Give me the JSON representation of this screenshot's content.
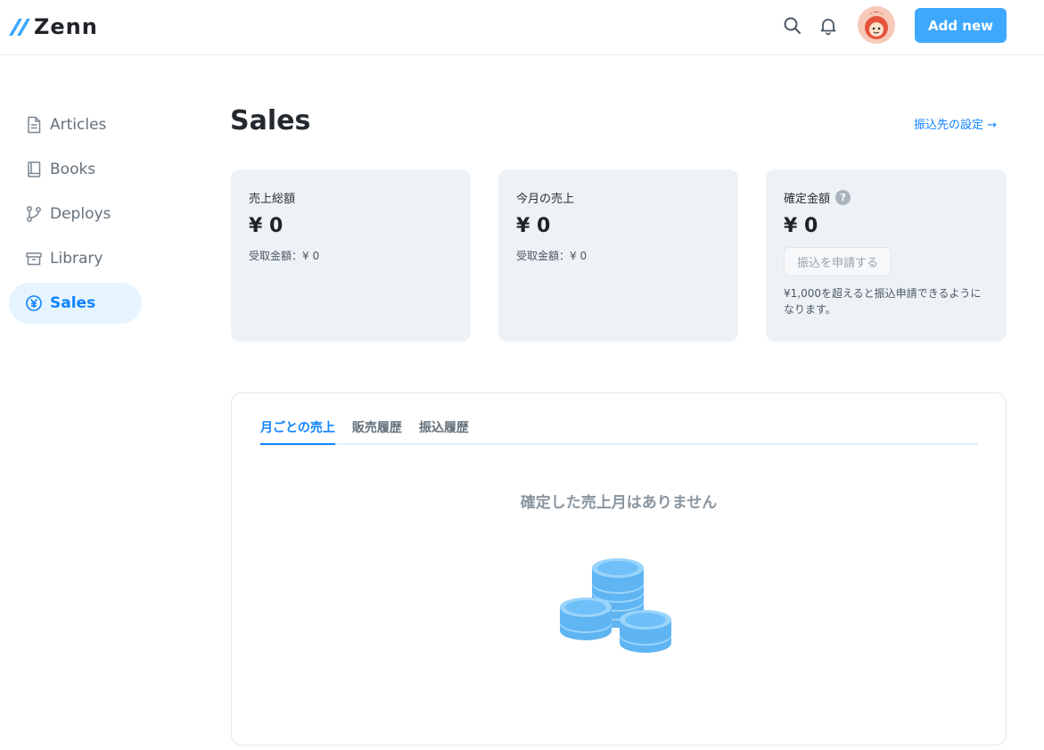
{
  "header": {
    "logo_text": "Zenn",
    "add_new_label": "Add new"
  },
  "sidebar": {
    "items": [
      {
        "label": "Articles",
        "icon": "document-icon"
      },
      {
        "label": "Books",
        "icon": "book-icon"
      },
      {
        "label": "Deploys",
        "icon": "git-branch-icon"
      },
      {
        "label": "Library",
        "icon": "archive-box-icon"
      },
      {
        "label": "Sales",
        "icon": "yen-circle-icon",
        "active": true
      }
    ]
  },
  "main": {
    "title": "Sales",
    "transfer_link": "振込先の設定 →",
    "cards": [
      {
        "label": "売上総額",
        "amount": "¥ 0",
        "sub": "受取金額：¥ 0"
      },
      {
        "label": "今月の売上",
        "amount": "¥ 0",
        "sub": "受取金額：¥ 0"
      },
      {
        "label": "確定金額",
        "help": "?",
        "amount": "¥ 0",
        "button": "振込を申請する",
        "note": "¥1,000を超えると振込申請できるようになります。"
      }
    ],
    "tabs": [
      "月ごとの売上",
      "販売履歴",
      "振込履歴"
    ],
    "active_tab": "月ごとの売上",
    "empty_message": "確定した売上月はありません"
  },
  "colors": {
    "accent": "#3ea8ff",
    "link": "#0f83fd",
    "card_bg": "#edf2f7",
    "active_nav_bg": "#e5f4ff"
  }
}
